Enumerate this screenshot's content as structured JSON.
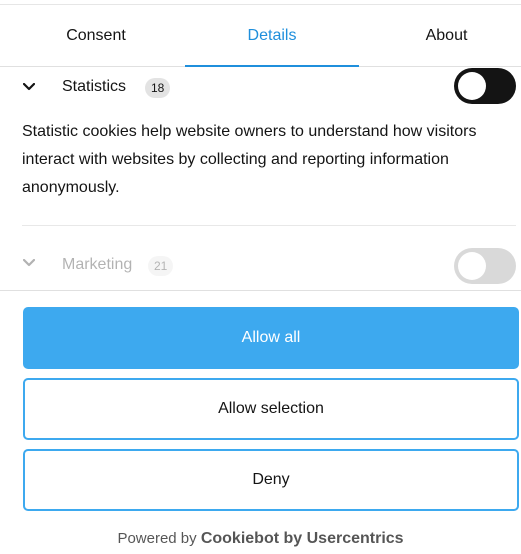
{
  "tabs": [
    {
      "label": "Consent",
      "active": false
    },
    {
      "label": "Details",
      "active": true
    },
    {
      "label": "About",
      "active": false
    }
  ],
  "categories": {
    "statistics": {
      "label": "Statistics",
      "count": "18",
      "enabled": true,
      "description": "Statistic cookies help website owners to understand how visitors interact with websites by collecting and reporting information anonymously."
    },
    "marketing": {
      "label": "Marketing",
      "count": "21",
      "enabled": false
    }
  },
  "buttons": {
    "allow_all": "Allow all",
    "allow_selection": "Allow selection",
    "deny": "Deny"
  },
  "footer": {
    "prefix": "Powered by",
    "brand": "Cookiebot by Usercentrics"
  },
  "colors": {
    "accent": "#1f8fdc",
    "primary_button": "#3da9ef",
    "toggle_on": "#141414"
  }
}
